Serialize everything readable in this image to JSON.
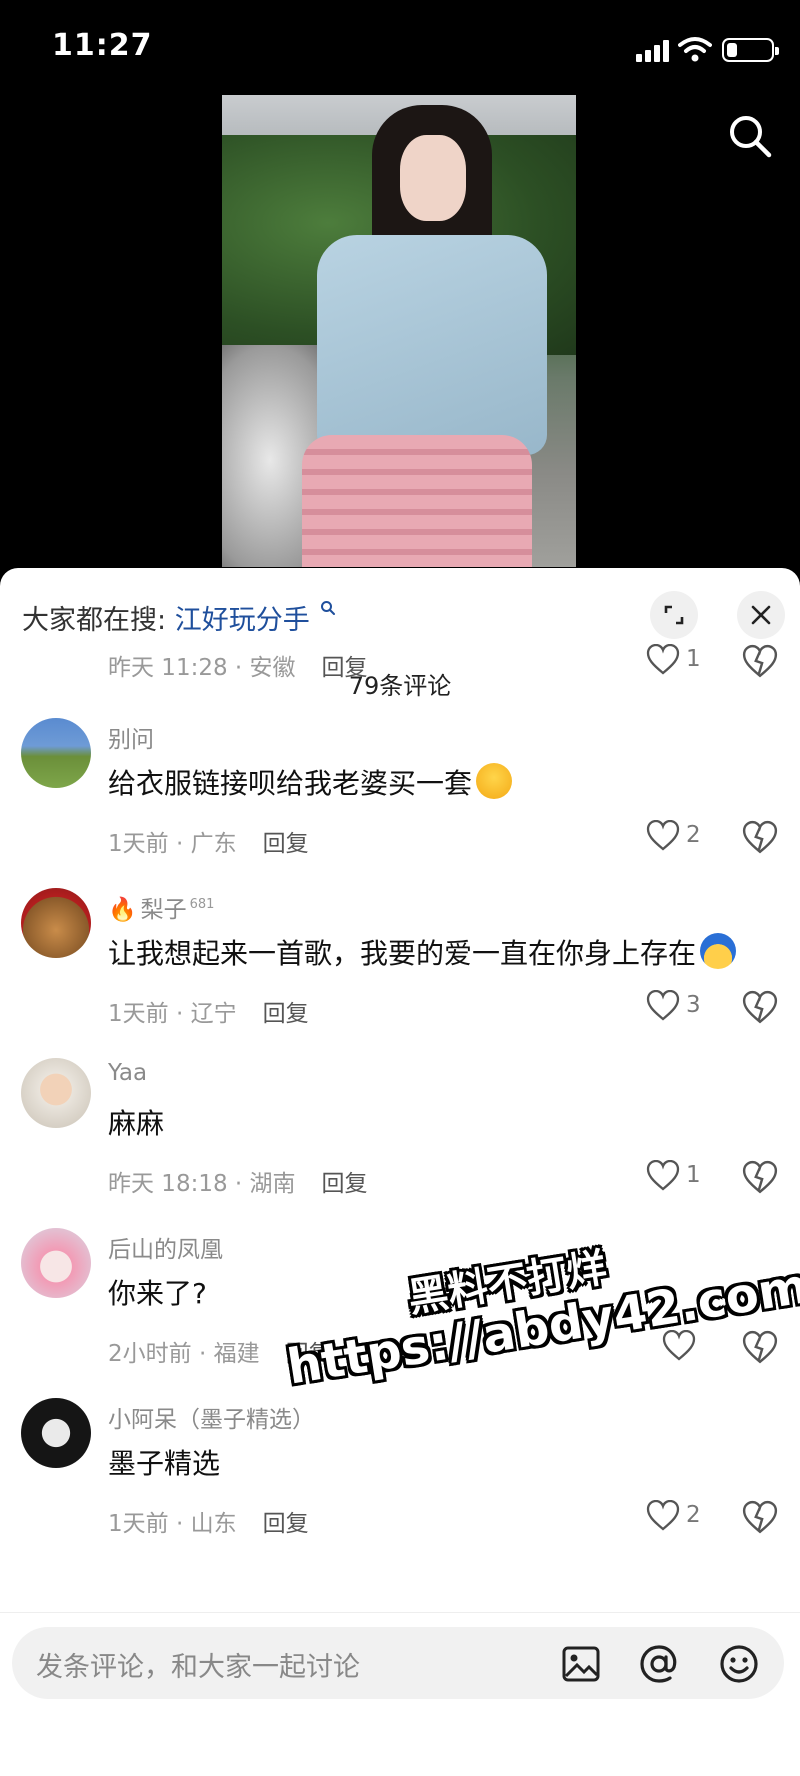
{
  "status_bar": {
    "time": "11:27"
  },
  "sheet": {
    "trending_prefix": "大家都在搜:",
    "trending_term": "江好玩分手",
    "comment_count": "79条评论"
  },
  "comments": [
    {
      "user": "",
      "text": "",
      "time_location": "昨天 11:28 · 安徽",
      "reply": "回复",
      "likes": "1"
    },
    {
      "user": "别问",
      "text": "给衣服链接呗给我老婆买一套",
      "emoji": "grinning-emoji",
      "time_location": "1天前 · 广东",
      "reply": "回复",
      "likes": "2"
    },
    {
      "user": "梨子",
      "badge": "681",
      "text": "让我想起来一首歌，我要的爱一直在你身上存在",
      "emoji": "blue-hair-emoji",
      "time_location": "1天前 · 辽宁",
      "reply": "回复",
      "likes": "3"
    },
    {
      "user": "Yaa",
      "text": "麻麻",
      "time_location": "昨天 18:18 · 湖南",
      "reply": "回复",
      "likes": "1"
    },
    {
      "user": "后山的凤凰",
      "text": "你来了?",
      "time_location": "2小时前 · 福建",
      "reply": "回复",
      "likes": ""
    },
    {
      "user": "小阿呆（墨子精选）",
      "text": "墨子精选",
      "time_location": "1天前 · 山东",
      "reply": "回复",
      "likes": "2"
    }
  ],
  "input": {
    "placeholder": "发条评论，和大家一起讨论"
  },
  "watermark": {
    "line1": "黑料不打烊",
    "line2": "https://abdy42.com"
  },
  "colors": {
    "link": "#1f4f9c",
    "background": "#000000",
    "sheet": "#ffffff"
  }
}
